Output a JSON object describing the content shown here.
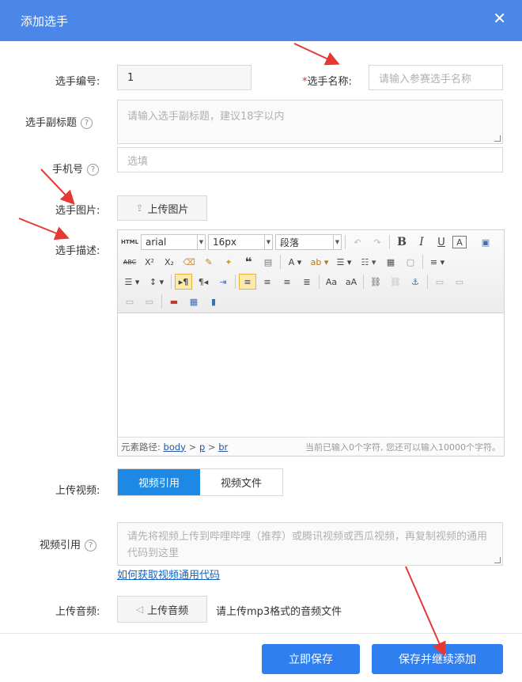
{
  "dialog": {
    "title": "添加选手",
    "close_icon": "close-icon"
  },
  "fields": {
    "player_no": {
      "label": "选手编号:",
      "value": "1"
    },
    "player_name": {
      "required_mark": "*",
      "label": "选手名称:",
      "placeholder": "请输入参赛选手名称"
    },
    "subtitle": {
      "label": "选手副标题",
      "placeholder": "请输入选手副标题，建议18字以内"
    },
    "phone": {
      "label": "手机号",
      "placeholder": "选填"
    },
    "image": {
      "label": "选手图片:",
      "button": "上传图片"
    },
    "desc": {
      "label": "选手描述:"
    }
  },
  "editor": {
    "font_family": "arial",
    "font_size": "16px",
    "paragraph": "段落",
    "status_prefix": "元素路径:",
    "path": [
      "body",
      "p",
      "br"
    ],
    "path_sep": ">",
    "count_text": "当前已输入0个字符, 您还可以输入10000个字符。"
  },
  "video": {
    "label": "上传视频:",
    "tabs": [
      "视频引用",
      "视频文件"
    ],
    "ref_label": "视频引用",
    "ref_placeholder": "请先将视频上传到哔哩哔哩（推荐）或腾讯视频或西瓜视频，再复制视频的通用代码到这里",
    "help_link": "如何获取视频通用代码"
  },
  "audio": {
    "label": "上传音频:",
    "button": "上传音频",
    "hint": "请上传mp3格式的音频文件"
  },
  "footer": {
    "save": "立即保存",
    "save_continue": "保存并继续添加"
  },
  "colors": {
    "header": "#4a87e8",
    "primary": "#2f7ff0",
    "annotation": "#e53935"
  }
}
